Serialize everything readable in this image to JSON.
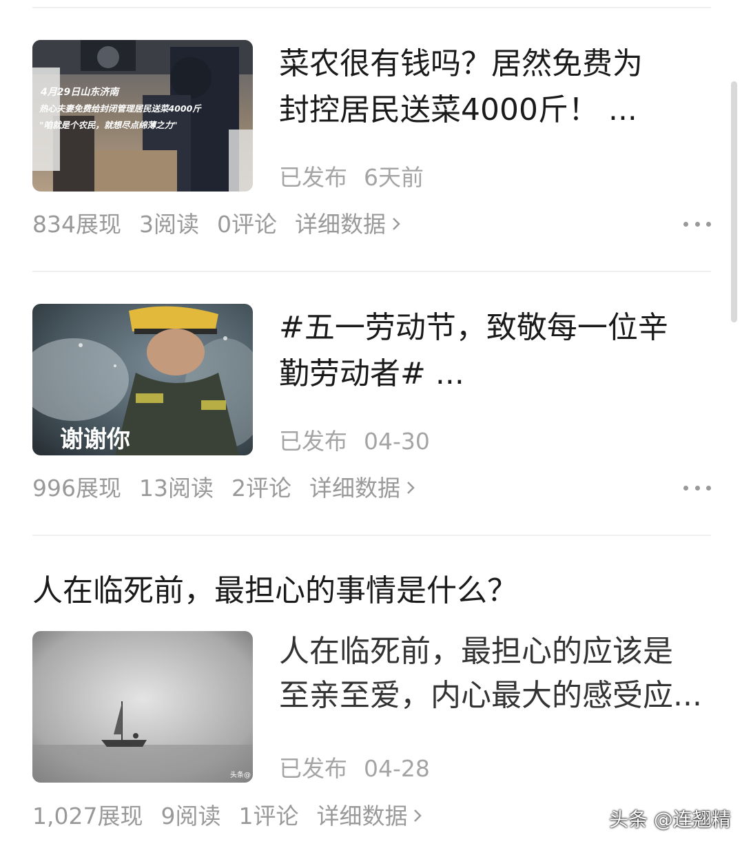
{
  "articles": [
    {
      "title": "菜农很有钱吗？居然免费为\n封控居民送菜4000斤！ ...",
      "image_caption": [
        "4月29日山东济南",
        "热心夫妻免费给封闭管理居民送菜4000斤",
        "\"咱就是个农民，就想尽点绵薄之力\""
      ],
      "status": "已发布",
      "time": "6天前",
      "impressions": "834展现",
      "reads": "3阅读",
      "comments": "0评论",
      "detail_label": "详细数据"
    },
    {
      "title": "#五一劳动节，致敬每一位辛\n勤劳动者# ...",
      "image_caption": [
        "谢谢你"
      ],
      "status": "已发布",
      "time": "04-30",
      "impressions": "996展现",
      "reads": "13阅读",
      "comments": "2评论",
      "detail_label": "详细数据"
    },
    {
      "full_title": "人在临死前，最担心的事情是什么？",
      "snippet": "人在临死前，最担心的应该是\n至亲至爱，内心最大的感受应...",
      "image_caption": [
        "头条@"
      ],
      "status": "已发布",
      "time": "04-28",
      "impressions": "1,027展现",
      "reads": "9阅读",
      "comments": "1评论",
      "detail_label": "详细数据"
    }
  ],
  "watermark": "头条 @连翘精",
  "icons": {
    "more": "more-horizontal-icon",
    "chevron": "chevron-right-icon"
  },
  "colors": {
    "text_primary": "#1a1a1a",
    "text_secondary": "#999999",
    "divider": "#efefef"
  }
}
